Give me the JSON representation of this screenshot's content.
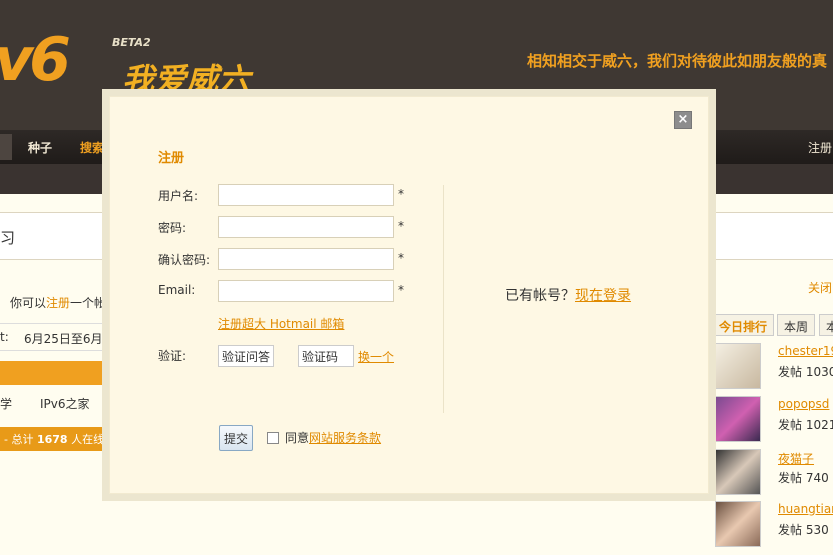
{
  "header": {
    "logo_text": "v6",
    "beta": "BETA2",
    "logo_cn": "我爱威六",
    "slogan": "相知相交于威六，我们对待彼此如朋友般的真"
  },
  "nav": {
    "items": [
      "种子",
      "搜索"
    ],
    "right": "注册"
  },
  "background": {
    "strip_text": "习",
    "tip_prefix": "你可以",
    "tip_link": "注册",
    "tip_suffix": "一个帐",
    "date": "6月25日至6月:",
    "date_prefix": "t:",
    "links": [
      "学",
      "IPv6之家"
    ],
    "total_prefix": "- 总计 ",
    "total_num": "1678",
    "total_suffix": " 人在线"
  },
  "sidebar": {
    "close": "关闭",
    "tabs": [
      "今日排行",
      "本周",
      "本"
    ],
    "items": [
      {
        "name": "chester19",
        "sub": "发帖 1030"
      },
      {
        "name": "popopsd",
        "sub": "发帖 1021"
      },
      {
        "name": "夜猫子",
        "sub": "发帖 740 "
      },
      {
        "name": "huangtian",
        "sub": "发帖 530 "
      }
    ]
  },
  "dialog": {
    "close": "×",
    "title": "注册",
    "username_label": "用户名:",
    "password_label": "密码:",
    "confirm_label": "确认密码:",
    "email_label": "Email:",
    "star": "*",
    "hotmail": "注册超大 Hotmail 邮箱",
    "verify_label": "验证:",
    "question_box": "验证问答",
    "code_box": "验证码",
    "refresh": "换一个",
    "have_account": "已有帐号？",
    "login_link": "现在登录",
    "submit": "提交",
    "agree_text": "同意",
    "agree_link": "网站服务条款"
  }
}
